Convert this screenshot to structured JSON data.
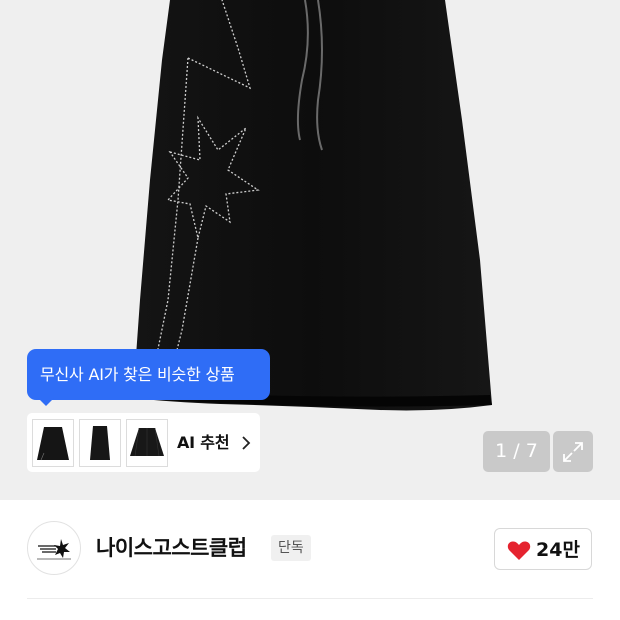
{
  "product_gallery": {
    "image_icon": "skirt-product-photo",
    "page_current": "1",
    "page_total": "7",
    "page_label": "1 / 7",
    "expand_icon": "expand-icon"
  },
  "ai_recommend": {
    "tooltip": "무신사 AI가 찾은 비슷한 상품",
    "label": "AI 추천",
    "chevron_icon": "chevron-right-icon",
    "accent_color": "#2f6df6",
    "thumbnails": [
      "similar-skirt-1",
      "similar-skirt-2",
      "similar-skirt-3"
    ]
  },
  "brand": {
    "name": "나이스고스트클럽",
    "badge": "단독",
    "logo_icon": "brand-logo-icon"
  },
  "like": {
    "count": "24만",
    "icon": "heart-icon",
    "color": "#e5232f"
  }
}
